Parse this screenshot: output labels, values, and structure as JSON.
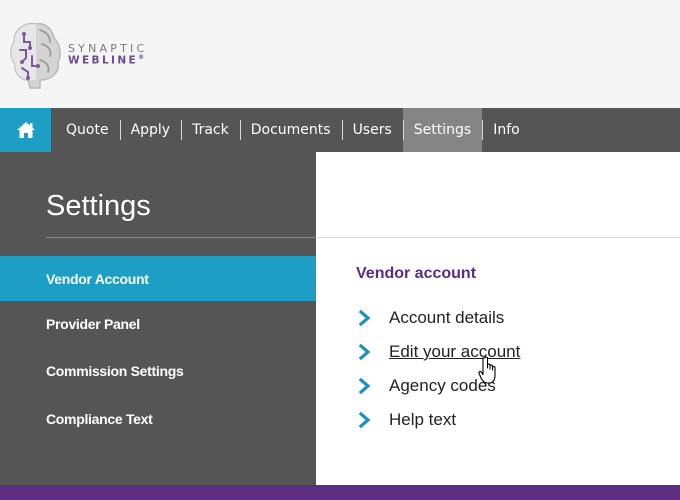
{
  "brand": {
    "line1": "SYNAPTIC",
    "line2": "WEBLINE",
    "mark": "®"
  },
  "nav": {
    "home_icon": "home-icon",
    "items": [
      {
        "label": "Quote"
      },
      {
        "label": "Apply"
      },
      {
        "label": "Track"
      },
      {
        "label": "Documents"
      },
      {
        "label": "Users"
      },
      {
        "label": "Settings",
        "active": true
      },
      {
        "label": "Info"
      }
    ]
  },
  "sidebar": {
    "title": "Settings",
    "items": [
      {
        "label": "Vendor Account",
        "active": true
      },
      {
        "label": "Provider Panel"
      },
      {
        "label": "Commission Settings"
      },
      {
        "label": "Compliance Text"
      }
    ]
  },
  "main": {
    "heading": "Vendor account",
    "links": [
      {
        "label": "Account details"
      },
      {
        "label": "Edit your account",
        "hovered": true
      },
      {
        "label": "Agency codes"
      },
      {
        "label": "Help text"
      }
    ]
  },
  "colors": {
    "accent": "#1d9ec4",
    "nav_bg": "#555555",
    "nav_active": "#858585",
    "brand_purple": "#5c2d80",
    "heading_purple": "#5a2d82"
  }
}
